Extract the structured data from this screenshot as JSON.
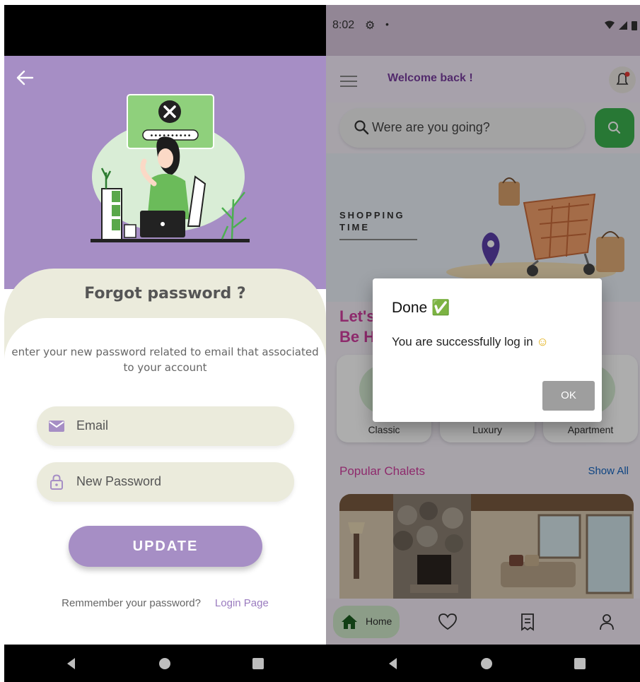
{
  "forgot_screen": {
    "title": "Forgot password ?",
    "description": "enter your new password related to email that associated to your account",
    "email_placeholder": "Email",
    "password_placeholder": "New Password",
    "update_label": "UPDATE",
    "remember_text": "Remmember your password?",
    "login_link": "Login Page",
    "illustration_password_mask": "••••••••••",
    "colors": {
      "accent": "#a68ec5",
      "cream": "#ebebdc"
    }
  },
  "home_screen": {
    "status_time": "8:02",
    "welcome": "Welcome back !",
    "search_placeholder": "Were are you going?",
    "banner_line1": "SHOPPING",
    "banner_line2": "TIME",
    "heading_line1": "Let's",
    "heading_line2": "Be H",
    "categories": [
      "Classic",
      "Luxury",
      "Apartment"
    ],
    "popular_title": "Popular Chalets",
    "show_all": "Show All",
    "nav_home": "Home",
    "colors": {
      "search_button": "#3bb24f",
      "headings": "#d23fa0",
      "link": "#1565c0"
    }
  },
  "dialog": {
    "title": "Done",
    "title_emoji": "✅",
    "message": "You are successfully log in",
    "message_emoji": "☺",
    "ok_label": "OK"
  },
  "system_nav": {
    "icons": [
      "back-icon",
      "home-circle-icon",
      "recents-square-icon"
    ]
  }
}
